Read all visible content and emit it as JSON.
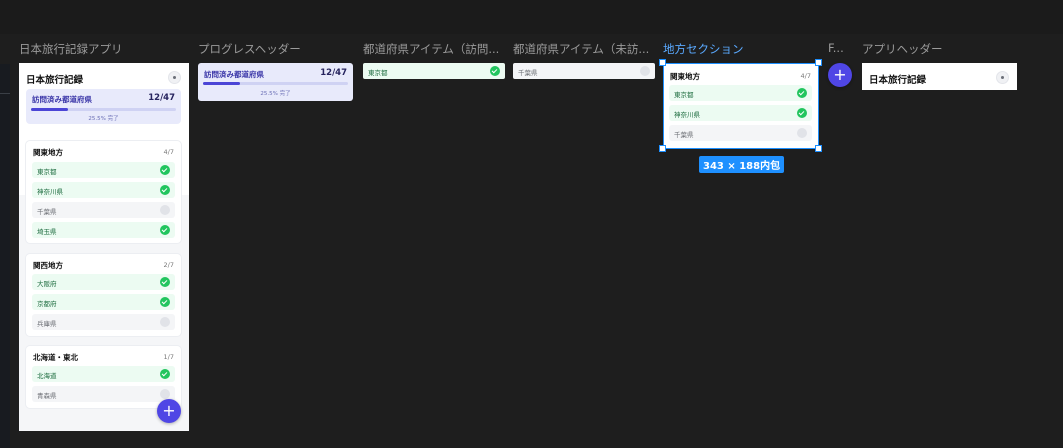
{
  "frame_labels": {
    "app": "日本旅行記録アプリ",
    "progress_header": "プログレスヘッダー",
    "pref_visited": "都道府県アイテム（訪問...",
    "pref_unvisited": "都道府県アイテム（未訪...",
    "region_section": "地方セクション",
    "fab": "F...",
    "app_header": "アプリヘッダー"
  },
  "app": {
    "title": "日本旅行記録",
    "progress": {
      "title": "訪問済み都道府県",
      "count": "12/47",
      "percent_text": "25.5% 完了",
      "fraction": 0.255
    },
    "regions": [
      {
        "name": "関東地方",
        "count": "4/7",
        "prefectures": [
          {
            "name": "東京都",
            "visited": true
          },
          {
            "name": "神奈川県",
            "visited": true
          },
          {
            "name": "千葉県",
            "visited": false
          },
          {
            "name": "埼玉県",
            "visited": true
          }
        ]
      },
      {
        "name": "関西地方",
        "count": "2/7",
        "prefectures": [
          {
            "name": "大阪府",
            "visited": true
          },
          {
            "name": "京都府",
            "visited": true
          },
          {
            "name": "兵庫県",
            "visited": false
          }
        ]
      },
      {
        "name": "北海道・東北",
        "count": "1/7",
        "prefectures": [
          {
            "name": "北海道",
            "visited": true
          },
          {
            "name": "青森県",
            "visited": false
          }
        ]
      }
    ],
    "fab_label": "+"
  },
  "progress_component": {
    "title": "訪問済み都道府県",
    "count": "12/47",
    "percent_text": "25.5% 完了",
    "fraction": 0.255
  },
  "pref_visited_component": {
    "name": "東京都"
  },
  "pref_unvisited_component": {
    "name": "千葉県"
  },
  "region_component": {
    "name": "関東地方",
    "count": "4/7",
    "prefectures": [
      {
        "name": "東京都",
        "visited": true
      },
      {
        "name": "神奈川県",
        "visited": true
      },
      {
        "name": "千葉県",
        "visited": false
      }
    ]
  },
  "selection_badge": "343 × 188内包",
  "fab_component": {
    "label": "+"
  },
  "header_component": {
    "title": "日本旅行記録"
  },
  "colors": {
    "accent": "#4f46e5",
    "visited": "#22c55e",
    "selection": "#1e90ff",
    "canvas": "#1e1e1e"
  }
}
